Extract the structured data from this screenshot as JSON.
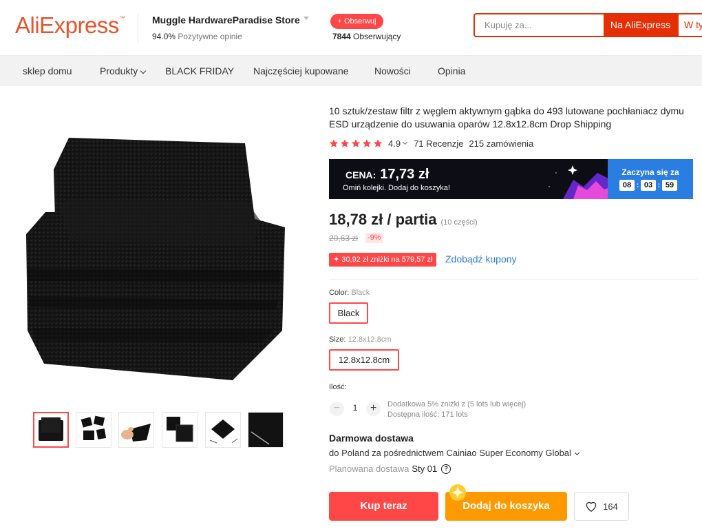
{
  "header": {
    "logo": "AliExpress",
    "logo_tm": "™",
    "store_name": "Muggle HardwareParadise Store",
    "positive_pct": "94.0%",
    "positive_label": "Pozytywne opinie",
    "follow_label": "+ Obserwuj",
    "followers_count": "7844",
    "followers_label": "Obserwujący",
    "search_placeholder": "Kupuję za...",
    "search_ali_label": "Na AliExpress",
    "search_store_label": "W ty"
  },
  "nav": {
    "items": [
      "sklep domu",
      "Produkty",
      "BLACK FRIDAY",
      "Najczęściej kupowane",
      "Nowości",
      "Opinia"
    ]
  },
  "product": {
    "title": "10 sztuk/zestaw filtr z węglem aktywnym gąbka do 493 lutowane pochłaniacz dymu ESD urządzenie do usuwania oparów 12.8x12.8cm Drop Shipping",
    "rating": "4.9",
    "stars": 5,
    "reviews": "71 Recenzje",
    "orders": "215 zamówienia"
  },
  "promo": {
    "cena_label": "CENA:",
    "cena_value": "17,73 zł",
    "subtitle": "Omiń kolejki. Dodaj do koszyka!",
    "timer_label": "Zaczyna się za",
    "timer": [
      "08",
      "03",
      "59"
    ]
  },
  "price": {
    "current": "18,78 zł / partia",
    "unit_note": "(10 części)",
    "old": "20,63 zł",
    "discount": "-9%",
    "coupon_badge": "✦ 30,92 zł zniżki na 579,57 zł",
    "coupon_link": "Zdobądź kupony"
  },
  "options": {
    "color_label": "Color:",
    "color_value": "Black",
    "color_option": "Black",
    "size_label": "Size:",
    "size_value": "12.8x12.8cm",
    "size_option": "12.8x12.8cm"
  },
  "quantity": {
    "label": "Ilość:",
    "minus": "−",
    "value": "1",
    "plus": "+",
    "info_line1": "Dodatkowa 5% zniżki z (5 lots lub więcej)",
    "info_line2": "Dostępna ilość: 171 lots"
  },
  "shipping": {
    "title": "Darmowa dostawa",
    "line": "do Poland za pośrednictwem Cainiao Super Economy Global",
    "planned_label": "Planowana dostawa",
    "planned_date": "Sty 01",
    "help": "?"
  },
  "actions": {
    "buy_now": "Kup teraz",
    "add_to_cart": "Dodaj do koszyka",
    "wishlist_count": "164"
  },
  "colors": {
    "brand": "#e62e04",
    "accent_red": "#ff4747",
    "orange": "#ff9900",
    "link_blue": "#2e7ad1",
    "star": "#ff4747"
  }
}
